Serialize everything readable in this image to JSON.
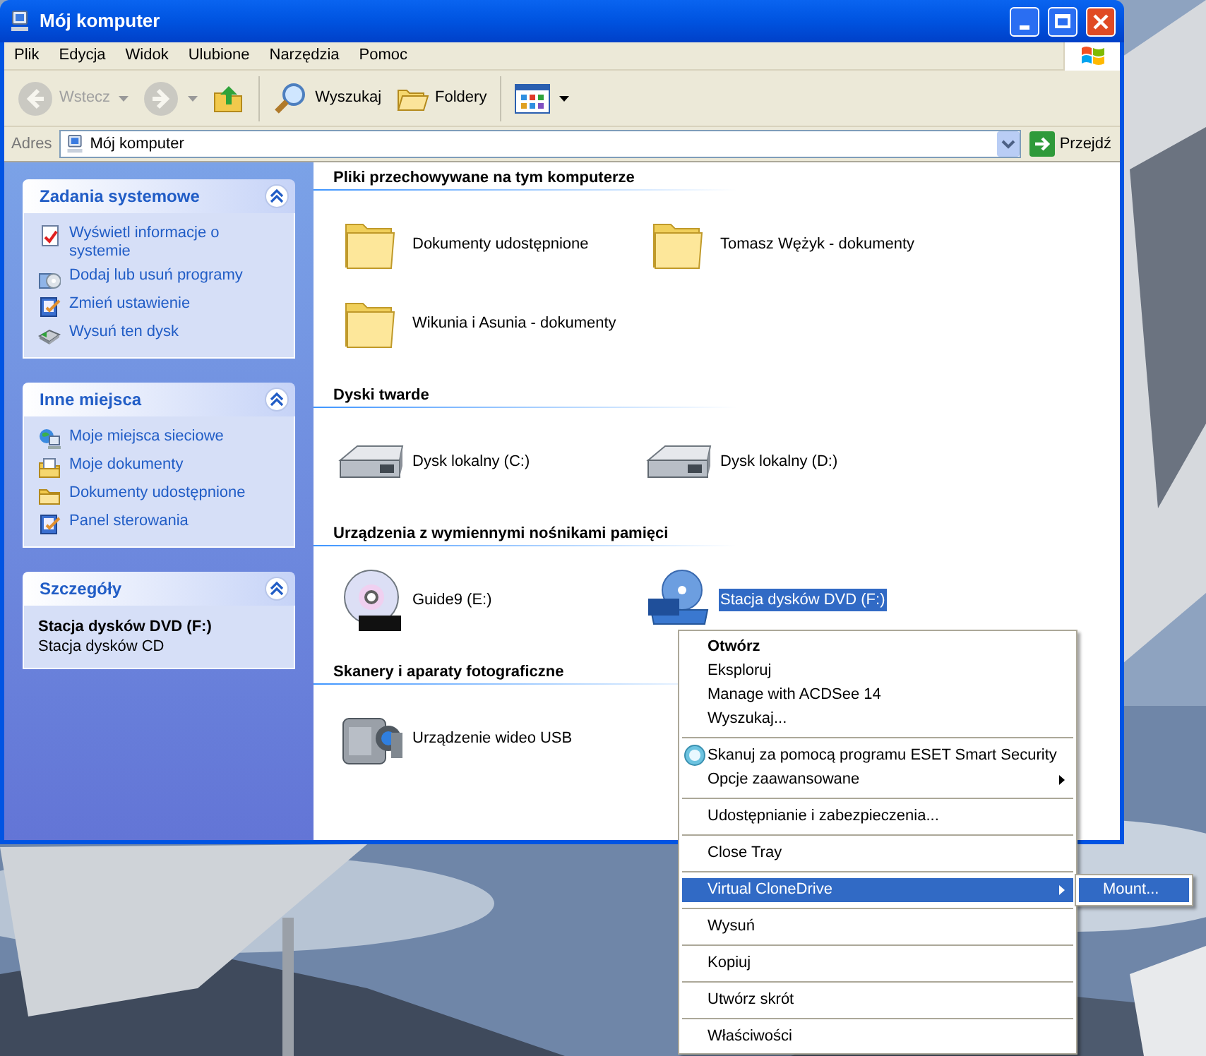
{
  "window": {
    "title": "Mój komputer"
  },
  "menu_bar": [
    "Plik",
    "Edycja",
    "Widok",
    "Ulubione",
    "Narzędzia",
    "Pomoc"
  ],
  "toolbar": [
    {
      "kind": "back",
      "label": "Wstecz",
      "disabled": true,
      "dropdown": true
    },
    {
      "kind": "forward",
      "disabled": true,
      "dropdown": true
    },
    {
      "kind": "up",
      "disabled": false,
      "dropdown": false
    },
    {
      "kind": "separator"
    },
    {
      "kind": "search",
      "label": "Wyszukaj",
      "disabled": false,
      "dropdown": false
    },
    {
      "kind": "folders",
      "label": "Foldery",
      "disabled": false,
      "dropdown": false
    },
    {
      "kind": "separator"
    },
    {
      "kind": "views",
      "disabled": false,
      "dropdown": true
    }
  ],
  "address_bar": {
    "label": "Adres",
    "value": "Mój komputer",
    "go": "Przejdź"
  },
  "sidebar": [
    {
      "title": "Zadania systemowe",
      "expanded": true,
      "links": [
        {
          "kind": "info",
          "label": "Wyświetl informacje o systemie"
        },
        {
          "kind": "programs",
          "label": "Dodaj lub usuń programy"
        },
        {
          "kind": "settings",
          "label": "Zmień ustawienie"
        },
        {
          "kind": "eject",
          "label": "Wysuń ten dysk"
        }
      ]
    },
    {
      "title": "Inne miejsca",
      "expanded": true,
      "links": [
        {
          "kind": "network",
          "label": "Moje miejsca sieciowe"
        },
        {
          "kind": "documents",
          "label": "Moje dokumenty"
        },
        {
          "kind": "folder",
          "label": "Dokumenty udostępnione"
        },
        {
          "kind": "settings",
          "label": "Panel sterowania"
        }
      ]
    },
    {
      "title": "Szczegóły",
      "expanded": true,
      "details": {
        "name": "Stacja dysków DVD (F:)",
        "type": "Stacja dysków CD"
      }
    }
  ],
  "sections": [
    {
      "title": "Pliki przechowywane na tym komputerze",
      "items": [
        {
          "kind": "folder",
          "label": "Dokumenty udostępnione",
          "selected": false
        },
        {
          "kind": "folder",
          "label": "Tomasz Wężyk - dokumenty",
          "selected": false
        },
        {
          "kind": "folder",
          "label": "Wikunia i Asunia - dokumenty",
          "selected": false
        }
      ]
    },
    {
      "title": "Dyski twarde",
      "items": [
        {
          "kind": "hdd",
          "label": "Dysk lokalny (C:)",
          "selected": false
        },
        {
          "kind": "hdd",
          "label": "Dysk lokalny (D:)",
          "selected": false
        }
      ]
    },
    {
      "title": "Urządzenia z wymiennymi nośnikami pamięci",
      "items": [
        {
          "kind": "dvd_r",
          "label": "Guide9 (E:)",
          "selected": false
        },
        {
          "kind": "dvd_drive",
          "label": "Stacja dysków DVD (F:)",
          "selected": true
        }
      ]
    },
    {
      "title": "Skanery i aparaty fotograficzne",
      "items": [
        {
          "kind": "camera",
          "label": "Urządzenie wideo USB",
          "selected": false
        }
      ]
    }
  ],
  "context_menu": {
    "groups": [
      [
        {
          "label": "Otwórz",
          "default": true,
          "selected": false,
          "has_submenu": false,
          "kind": "plain"
        },
        {
          "label": "Eksploruj",
          "default": false,
          "selected": false,
          "has_submenu": false,
          "kind": "plain"
        },
        {
          "label": "Manage with ACDSee 14",
          "default": false,
          "selected": false,
          "has_submenu": false,
          "kind": "plain"
        },
        {
          "label": "Wyszukaj...",
          "default": false,
          "selected": false,
          "has_submenu": false,
          "kind": "plain"
        }
      ],
      [
        {
          "label": "Skanuj za pomocą programu ESET Smart Security",
          "default": false,
          "selected": false,
          "has_submenu": false,
          "kind": "scan"
        },
        {
          "label": "Opcje zaawansowane",
          "default": false,
          "selected": false,
          "has_submenu": true,
          "kind": "plain"
        }
      ],
      [
        {
          "label": "Udostępnianie i zabezpieczenia...",
          "default": false,
          "selected": false,
          "has_submenu": false,
          "kind": "plain"
        }
      ],
      [
        {
          "label": "Close Tray",
          "default": false,
          "selected": false,
          "has_submenu": false,
          "kind": "plain"
        }
      ],
      [
        {
          "label": "Virtual CloneDrive",
          "default": false,
          "selected": true,
          "has_submenu": true,
          "kind": "plain",
          "submenu": [
            {
              "label": "Mount...",
              "selected": true
            }
          ]
        }
      ],
      [
        {
          "label": "Wysuń",
          "default": false,
          "selected": false,
          "has_submenu": false,
          "kind": "plain"
        }
      ],
      [
        {
          "label": "Kopiuj",
          "default": false,
          "selected": false,
          "has_submenu": false,
          "kind": "plain"
        }
      ],
      [
        {
          "label": "Utwórz skrót",
          "default": false,
          "selected": false,
          "has_submenu": false,
          "kind": "plain"
        }
      ],
      [
        {
          "label": "Właściwości",
          "default": false,
          "selected": false,
          "has_submenu": false,
          "kind": "plain"
        }
      ]
    ]
  }
}
